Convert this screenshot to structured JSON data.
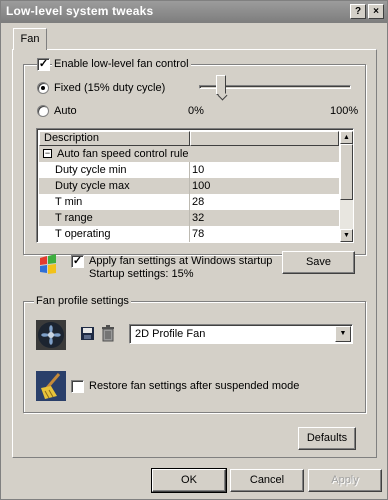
{
  "window": {
    "title": "Low-level system tweaks",
    "help_glyph": "?",
    "close_glyph": "×"
  },
  "tabs": [
    {
      "label": "Fan"
    }
  ],
  "fan_control": {
    "enable_label": "Enable low-level fan control",
    "enable_checked": true,
    "fixed_label": "Fixed (15% duty cycle)",
    "auto_label": "Auto",
    "selected_mode": "fixed",
    "slider_min_label": "0%",
    "slider_max_label": "100%",
    "slider_value_percent": 15
  },
  "rule_list": {
    "columns": [
      "Description",
      ""
    ],
    "group_label": "Auto fan speed control rule",
    "group_toggle": "−",
    "rows": [
      {
        "name": "Duty cycle min",
        "value": "10"
      },
      {
        "name": "Duty cycle max",
        "value": "100"
      },
      {
        "name": "T min",
        "value": "28"
      },
      {
        "name": "T range",
        "value": "32"
      },
      {
        "name": "T operating",
        "value": "78"
      }
    ]
  },
  "startup": {
    "apply_label": "Apply fan settings at Windows startup",
    "apply_checked": true,
    "settings_text": "Startup settings:  15%",
    "save_label": "Save"
  },
  "profiles": {
    "group_label": "Fan profile settings",
    "selected_profile": "2D Profile Fan",
    "icons": [
      "fan-icon",
      "save-disk-icon",
      "trash-icon"
    ]
  },
  "restore": {
    "label": "Restore fan settings after suspended mode",
    "checked": false
  },
  "buttons": {
    "defaults": "Defaults",
    "ok": "OK",
    "cancel": "Cancel",
    "apply": "Apply"
  },
  "colors": {
    "face": "#d4d0c8",
    "title_bar": "#8a8a8a",
    "list_background": "#ffffff",
    "list_row_alt": "#d4d0c8"
  }
}
